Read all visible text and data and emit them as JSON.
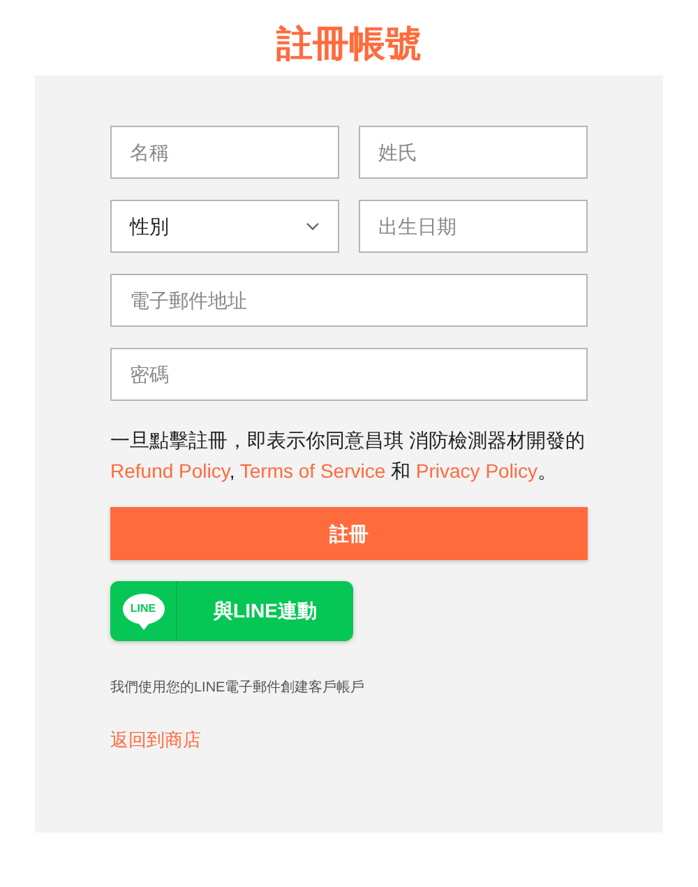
{
  "title": "註冊帳號",
  "fields": [
    [
      {
        "kind": "input",
        "placeholder": "名稱"
      },
      {
        "kind": "input",
        "placeholder": "姓氏"
      }
    ],
    [
      {
        "kind": "select",
        "value": "性別"
      },
      {
        "kind": "input",
        "placeholder": "出生日期"
      }
    ],
    [
      {
        "kind": "input",
        "placeholder": "電子郵件地址"
      }
    ],
    [
      {
        "kind": "password",
        "placeholder": "密碼"
      }
    ]
  ],
  "agreement": [
    {
      "kind": "text",
      "text": "一旦點擊註冊，即表示你同意昌琪 消防檢測器材開發的 "
    },
    {
      "kind": "link",
      "text": "Refund Policy"
    },
    {
      "kind": "text",
      "text": ", "
    },
    {
      "kind": "link",
      "text": "Terms of Service"
    },
    {
      "kind": "text",
      "text": " 和 "
    },
    {
      "kind": "link",
      "text": "Privacy Policy"
    },
    {
      "kind": "text",
      "text": "。"
    }
  ],
  "register_button": "註冊",
  "line_button": {
    "logo_text": "LINE",
    "label": "與LINE連動"
  },
  "note": "我們使用您的LINE電子郵件創建客戶帳戶",
  "back_link": "返回到商店"
}
